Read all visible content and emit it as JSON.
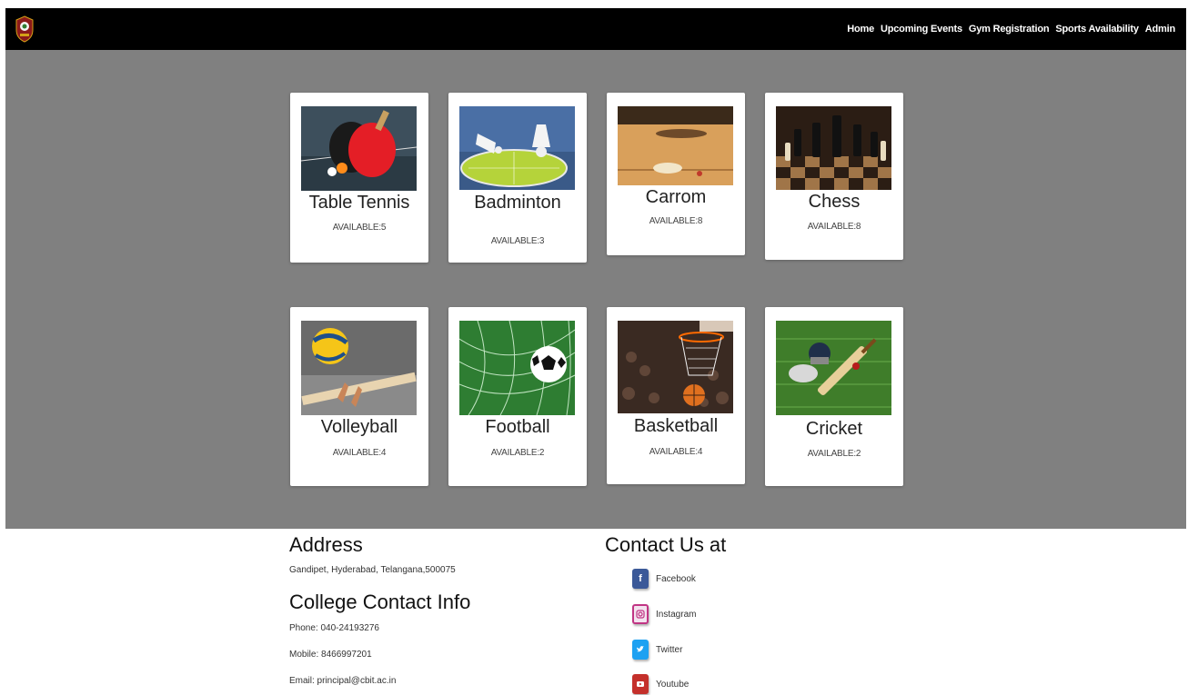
{
  "nav": {
    "links": [
      "Home",
      "Upcoming Events",
      "Gym Registration",
      "Sports Availability",
      "Admin"
    ]
  },
  "sports": [
    {
      "name": "Table Tennis",
      "availability": "AVAILABLE:5"
    },
    {
      "name": "Badminton",
      "availability": "AVAILABLE:3"
    },
    {
      "name": "Carrom",
      "availability": "AVAILABLE:8"
    },
    {
      "name": "Chess",
      "availability": "AVAILABLE:8"
    },
    {
      "name": "Volleyball",
      "availability": "AVAILABLE:4"
    },
    {
      "name": "Football",
      "availability": "AVAILABLE:2"
    },
    {
      "name": "Basketball",
      "availability": "AVAILABLE:4"
    },
    {
      "name": "Cricket",
      "availability": "AVAILABLE:2"
    }
  ],
  "footer": {
    "address_heading": "Address",
    "address": "Gandipet, Hyderabad, Telangana,500075",
    "contact_heading": "College Contact Info",
    "phone": "Phone: 040-24193276",
    "mobile": "Mobile: 8466997201",
    "email": "Email: principal@cbit.ac.in",
    "contact_us_heading": "Contact Us at",
    "social": [
      {
        "label": "Facebook",
        "icon": "facebook-icon",
        "color": "#3b5998"
      },
      {
        "label": "Instagram",
        "icon": "instagram-icon",
        "color": "#c13584"
      },
      {
        "label": "Twitter",
        "icon": "twitter-icon",
        "color": "#1da1f2"
      },
      {
        "label": "Youtube",
        "icon": "youtube-icon",
        "color": "#c4302b"
      }
    ]
  },
  "colors": {
    "navbar": "#000000",
    "main_bg": "#808080",
    "card_bg": "#ffffff"
  }
}
